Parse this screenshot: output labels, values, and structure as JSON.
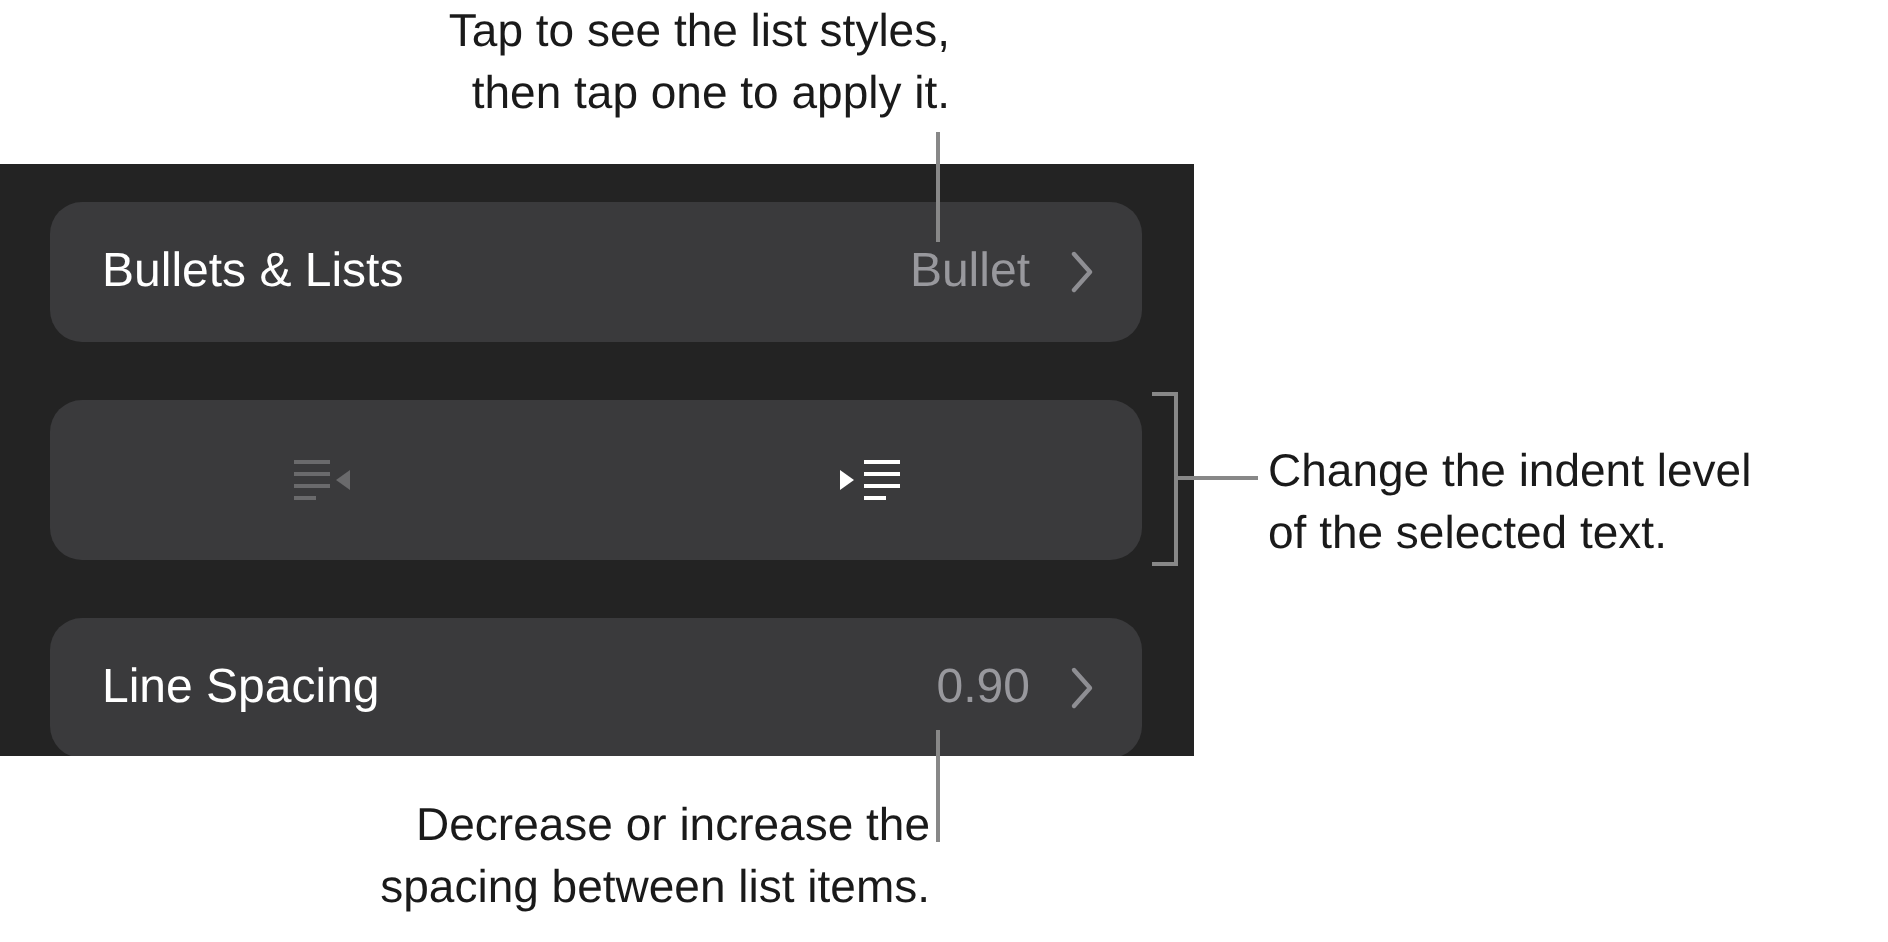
{
  "callouts": {
    "top": "Tap to see the list styles,\nthen tap one to apply it.",
    "right": "Change the indent level\nof the selected text.",
    "bottom": "Decrease or increase the\nspacing between list items."
  },
  "rows": [
    {
      "kind": "value",
      "label": "Bullets & Lists",
      "value": "Bullet"
    },
    {
      "kind": "indent",
      "buttons": [
        {
          "kind": "outdent",
          "disabled": true
        },
        {
          "kind": "indent",
          "disabled": false
        }
      ]
    },
    {
      "kind": "value",
      "label": "Line Spacing",
      "value": "0.90"
    }
  ]
}
